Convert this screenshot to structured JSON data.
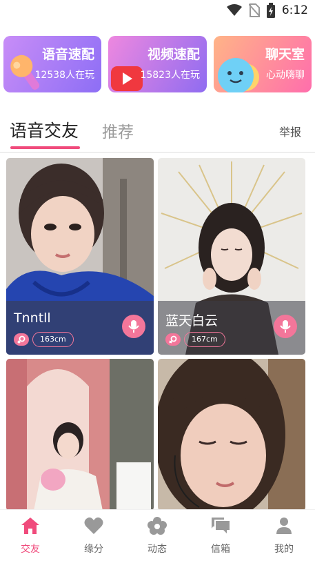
{
  "status_bar": {
    "time": "6:12"
  },
  "quick_cards": [
    {
      "title": "语音速配",
      "subtitle": "12538人在玩"
    },
    {
      "title": "视频速配",
      "subtitle": "15823人在玩"
    },
    {
      "title": "聊天室",
      "subtitle": "心动嗨聊"
    }
  ],
  "tabs": {
    "active": "语音交友",
    "inactive": "推荐"
  },
  "report_label": "举报",
  "profiles": [
    {
      "name": "Tnntll",
      "height": "163cm",
      "gender": "female"
    },
    {
      "name": "蓝天白云",
      "height": "167cm",
      "gender": "female"
    },
    {
      "name": "",
      "height": "",
      "gender": "female"
    },
    {
      "name": "",
      "height": "",
      "gender": "female"
    }
  ],
  "bottom_nav": [
    {
      "label": "交友",
      "icon": "home-icon",
      "active": true
    },
    {
      "label": "缘分",
      "icon": "heart-icon",
      "active": false
    },
    {
      "label": "动态",
      "icon": "flower-icon",
      "active": false
    },
    {
      "label": "信箱",
      "icon": "chat-bubbles-icon",
      "active": false
    },
    {
      "label": "我的",
      "icon": "person-icon",
      "active": false
    }
  ],
  "colors": {
    "accent": "#f04b7c",
    "tag_pink": "#f3769a"
  }
}
